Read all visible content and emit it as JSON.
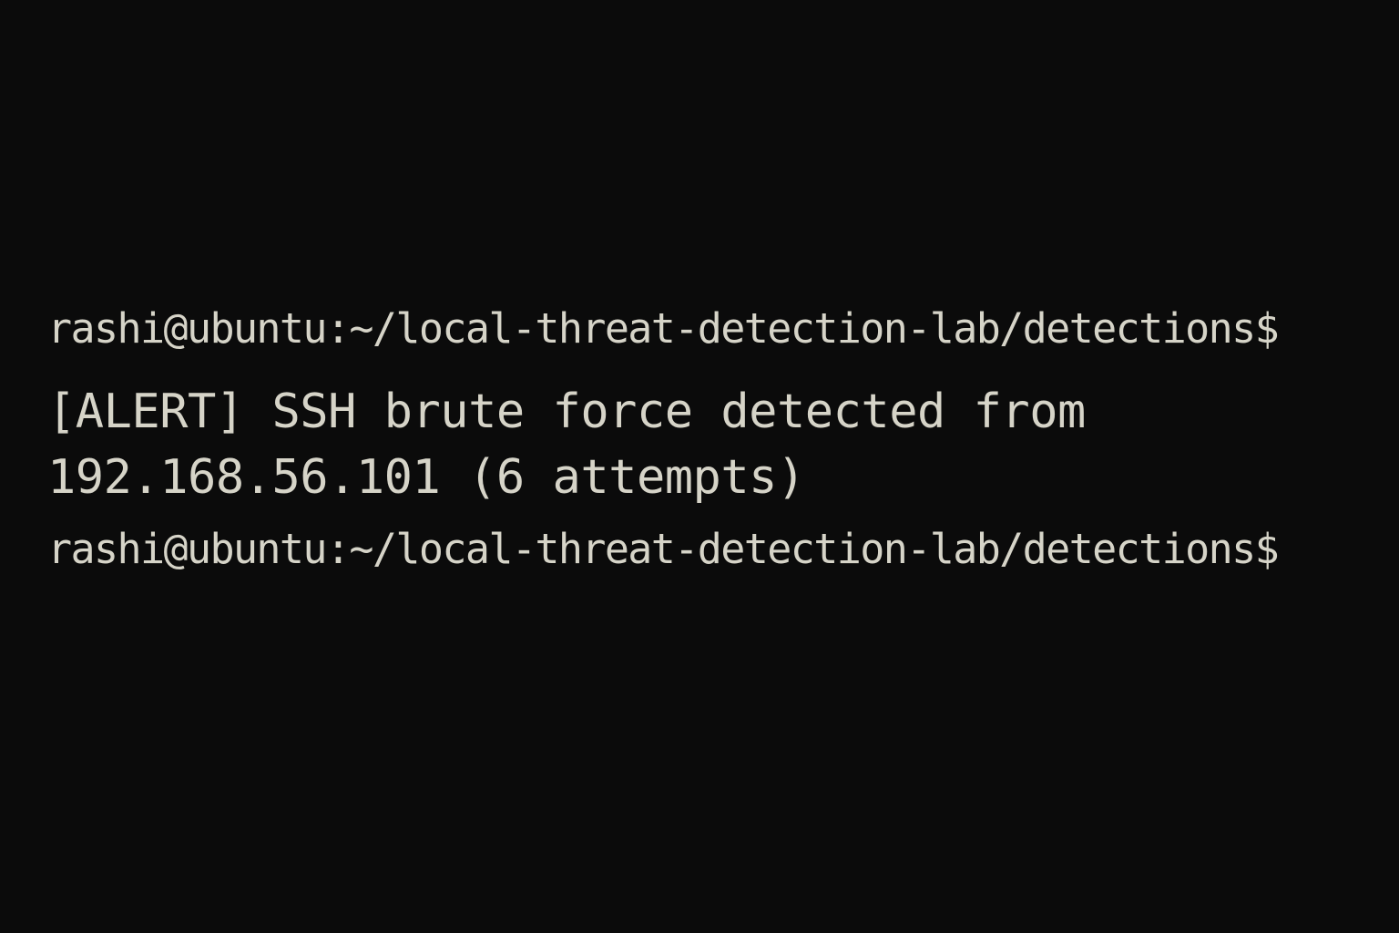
{
  "terminal": {
    "lines": [
      {
        "type": "prompt",
        "text": "rashi@ubuntu:~/local-threat-detection-lab/detections$"
      },
      {
        "type": "output",
        "text": "[ALERT] SSH brute force detected from"
      },
      {
        "type": "output",
        "text": "192.168.56.101 (6 attempts)"
      },
      {
        "type": "prompt",
        "text": "rashi@ubuntu:~/local-threat-detection-lab/detections$"
      }
    ]
  },
  "colors": {
    "background": "#0b0b0b",
    "foreground": "#d6d4c8"
  }
}
